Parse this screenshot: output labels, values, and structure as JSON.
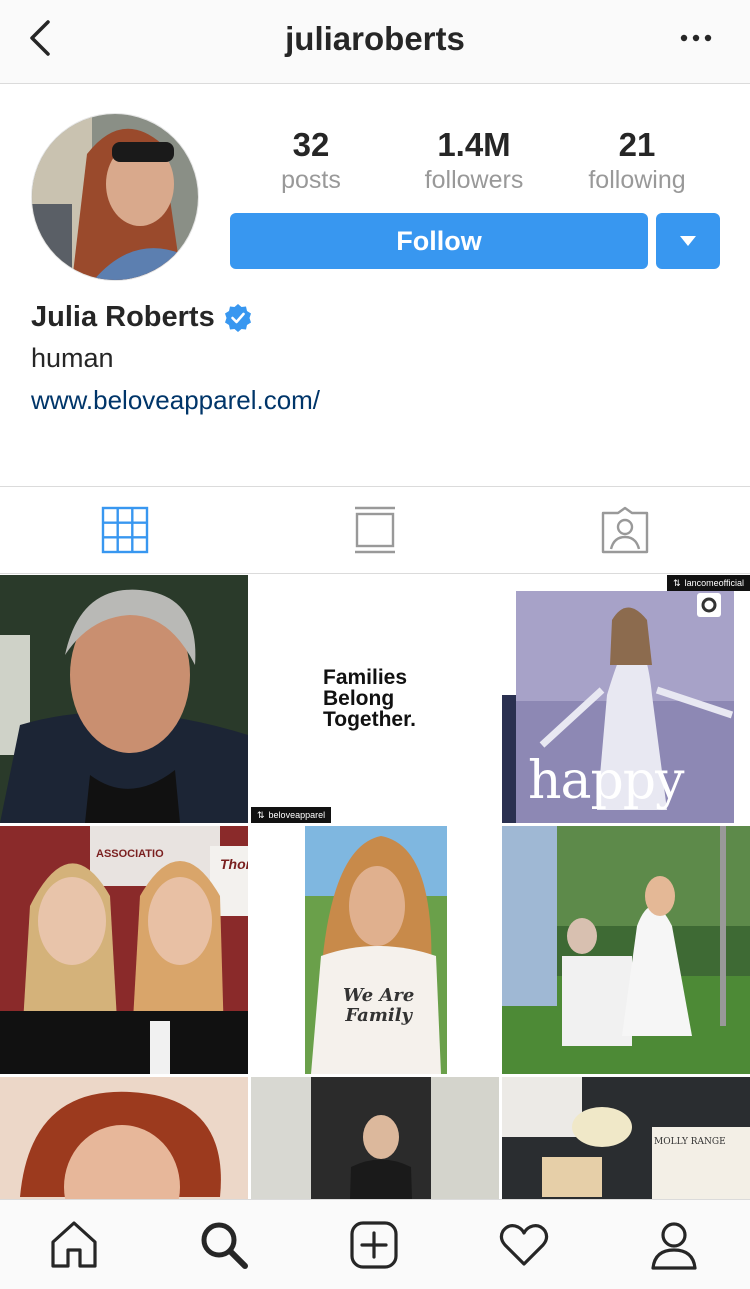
{
  "header": {
    "username": "juliaroberts"
  },
  "profile": {
    "stats": [
      {
        "value": "32",
        "label": "posts"
      },
      {
        "value": "1.4M",
        "label": "followers"
      },
      {
        "value": "21",
        "label": "following"
      }
    ],
    "follow_label": "Follow",
    "name": "Julia Roberts",
    "bio": "human",
    "website": "www.beloveapparel.com/"
  },
  "tabs": [
    "grid-icon",
    "feed-icon",
    "tagged-icon"
  ],
  "grid": {
    "tile2_text": [
      "Families",
      "Belong",
      "Together."
    ],
    "tile2_tag": "beloveapparel",
    "tile3_tag": "lancomeofficial",
    "tile3_caption": "happy",
    "tile4_sign": "ASSOCIATIO",
    "tile4_sign2": "Thor",
    "tile5_shirt": [
      "We Are",
      "Family"
    ],
    "tile9_book": "MOLLY RANGE"
  },
  "bottom_nav": [
    "home-icon",
    "search-icon",
    "new-post-icon",
    "activity-icon",
    "profile-icon"
  ],
  "colors": {
    "accent": "#3897f0",
    "link": "#003569",
    "verified": "#3897f0"
  }
}
